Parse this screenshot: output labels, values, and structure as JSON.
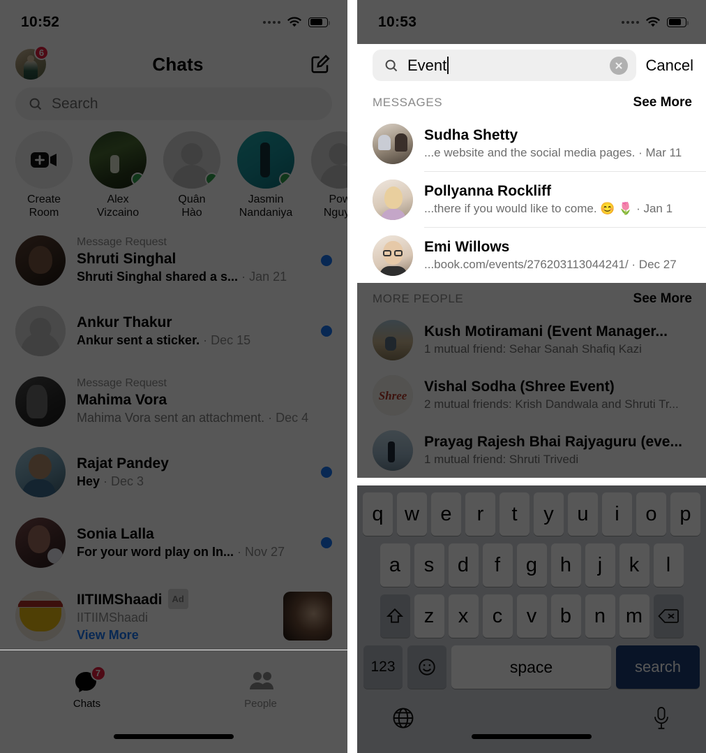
{
  "left_phone": {
    "status": {
      "time": "10:52",
      "signal_icon": "signal-dots-icon",
      "wifi_icon": "wifi-icon",
      "battery_icon": "battery-icon"
    },
    "header": {
      "title": "Chats",
      "avatar_badge": "6",
      "compose_icon": "compose-icon",
      "profile_icon": "profile-avatar"
    },
    "search": {
      "placeholder": "Search",
      "icon": "search-icon"
    },
    "stories": [
      {
        "label": "Create\nRoom",
        "line1": "Create",
        "line2": "Room",
        "type": "create-room",
        "online": false
      },
      {
        "line1": "Alex",
        "line2": "Vizcaino",
        "type": "photo-forest",
        "online": true
      },
      {
        "line1": "Quân",
        "line2": "Hào",
        "type": "placeholder",
        "online": true
      },
      {
        "line1": "Jasmin",
        "line2": "Nandaniya",
        "type": "photo-teal",
        "online": true
      },
      {
        "line1": "Pow",
        "line2": "Nguye",
        "type": "placeholder",
        "online": false
      }
    ],
    "chats": [
      {
        "tag": "Message Request",
        "name": "Shruti Singhal",
        "preview": "Shruti Singhal shared a s...",
        "time": "Jan 21",
        "unread": true,
        "muted": false,
        "avatar": "photo-woman-dark"
      },
      {
        "tag": "",
        "name": "Ankur Thakur",
        "preview": "Ankur sent a sticker.",
        "time": "Dec 15",
        "unread": true,
        "muted": false,
        "avatar": "placeholder"
      },
      {
        "tag": "Message Request",
        "name": "Mahima Vora",
        "preview": "Mahima Vora sent an attachment.",
        "time": "Dec 4",
        "unread": false,
        "muted": true,
        "avatar": "photo-bw"
      },
      {
        "tag": "",
        "name": "Rajat Pandey",
        "preview": "Hey",
        "time": "Dec 3",
        "unread": true,
        "muted": false,
        "avatar": "photo-man"
      },
      {
        "tag": "",
        "name": "Sonia Lalla",
        "preview": "For your word play on In...",
        "time": "Nov 27",
        "unread": true,
        "muted": false,
        "avatar": "photo-woman"
      }
    ],
    "ad": {
      "title": "IITIIMShaadi",
      "badge": "Ad",
      "subtitle": "IITIIMShaadi",
      "link": "View More",
      "thumb": "ad-thumbnail"
    },
    "tabbar": {
      "items": [
        {
          "label": "Chats",
          "icon": "chat-bubble-icon",
          "badge": "7",
          "active": true
        },
        {
          "label": "People",
          "icon": "people-icon",
          "badge": "",
          "active": false
        }
      ]
    }
  },
  "right_phone": {
    "status": {
      "time": "10:53",
      "signal_icon": "signal-dots-icon",
      "wifi_icon": "wifi-icon",
      "battery_icon": "battery-icon"
    },
    "search": {
      "value": "Event",
      "placeholder": "Search",
      "icon": "search-icon",
      "clear_icon": "clear-circle-icon",
      "cancel_label": "Cancel"
    },
    "sections": [
      {
        "title": "MESSAGES",
        "see_more": "See More",
        "dimmed": false,
        "rows": [
          {
            "name": "Sudha Shetty",
            "snippet": "...e website and the social media pages.",
            "time": "Mar 11",
            "avatar": "photo-couple"
          },
          {
            "name": "Pollyanna Rockliff",
            "snippet": "...there if you would like to come. 😊 🌷",
            "time": "Jan 1",
            "avatar": "photo-blonde"
          },
          {
            "name": "Emi Willows",
            "snippet": "...book.com/events/276203113044241/",
            "time": "Dec 27",
            "avatar": "photo-glasses"
          }
        ]
      },
      {
        "title": "MORE PEOPLE",
        "see_more": "See More",
        "dimmed": true,
        "rows": [
          {
            "name": "Kush Motiramani (Event Manager...",
            "snippet": "1 mutual friend: Sehar Sanah Shafiq Kazi",
            "time": "",
            "avatar": "photo-beach"
          },
          {
            "name": "Vishal Sodha (Shree Event)",
            "snippet": "2 mutual friends: Krish Dandwala and Shruti Tr...",
            "time": "",
            "avatar": "logo-shree"
          },
          {
            "name": "Prayag Rajesh Bhai Rajyaguru (eve...",
            "snippet": "1 mutual friend: Shruti Trivedi",
            "time": "",
            "avatar": "photo-person"
          }
        ]
      }
    ],
    "keyboard": {
      "row1": [
        "q",
        "w",
        "e",
        "r",
        "t",
        "y",
        "u",
        "i",
        "o",
        "p"
      ],
      "row2": [
        "a",
        "s",
        "d",
        "f",
        "g",
        "h",
        "j",
        "k",
        "l"
      ],
      "row3": [
        "z",
        "x",
        "c",
        "v",
        "b",
        "n",
        "m"
      ],
      "shift_icon": "shift-arrow-icon",
      "backspace_icon": "backspace-icon",
      "numbers_label": "123",
      "emoji_icon": "emoji-smiley-icon",
      "space_label": "space",
      "search_label": "search",
      "globe_icon": "globe-icon",
      "mic_icon": "microphone-icon"
    }
  },
  "colors": {
    "accent_blue": "#1877f2",
    "unread_dot": "#1877f2",
    "badge_red": "#e41e3f",
    "online_green": "#31a24c",
    "key_search_blue": "#1b3d73",
    "dim_overlay": "rgba(0,0,0,0.66)"
  }
}
